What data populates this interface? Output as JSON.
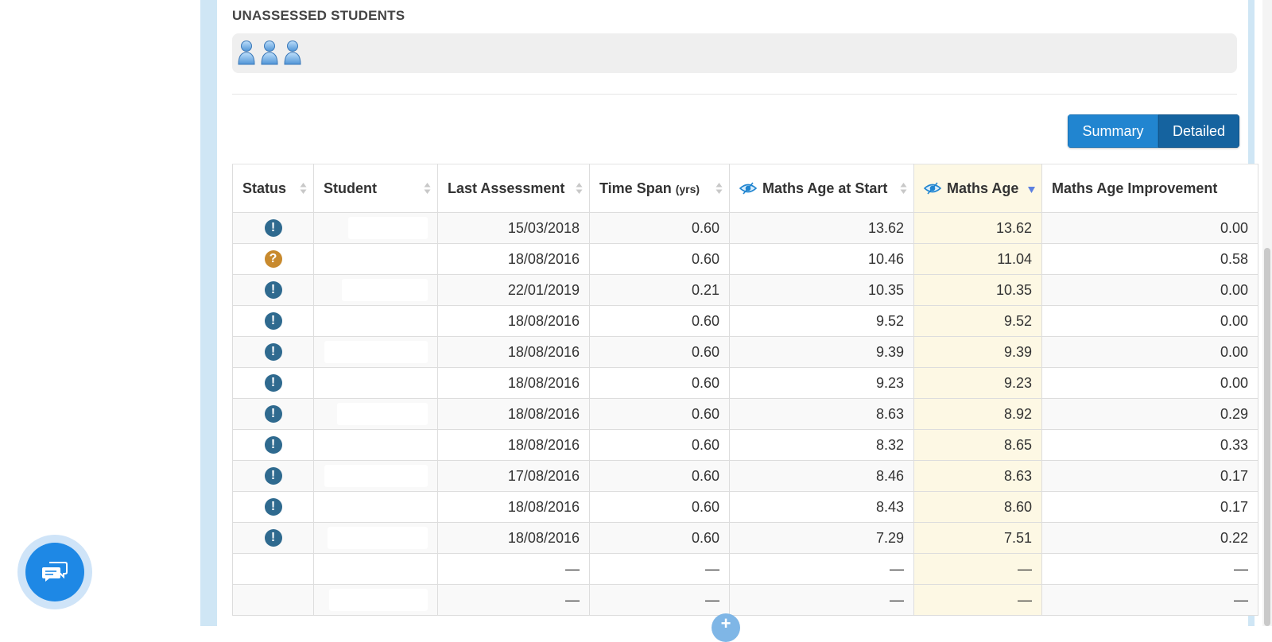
{
  "unassessed": {
    "title": "UNASSESSED STUDENTS",
    "student_icons": [
      "person-icon",
      "person-icon",
      "person-icon"
    ]
  },
  "view_toggle": {
    "summary_label": "Summary",
    "detailed_label": "Detailed",
    "active": "Detailed"
  },
  "table": {
    "columns": {
      "status": "Status",
      "student": "Student",
      "last_assessment": "Last Assessment",
      "time_span": "Time Span",
      "time_span_unit": "(yrs)",
      "maths_age_start": "Maths Age at Start",
      "maths_age": "Maths Age",
      "maths_age_improvement": "Maths Age Improvement"
    },
    "sorted_column": "Maths Age",
    "sort_direction": "descending",
    "rows": [
      {
        "status": "alert",
        "status_glyph": "!",
        "last_assessment": "15/03/2018",
        "time_span": "0.60",
        "maths_age_start": "13.62",
        "maths_age": "13.62",
        "improvement": "0.00"
      },
      {
        "status": "question",
        "status_glyph": "?",
        "last_assessment": "18/08/2016",
        "time_span": "0.60",
        "maths_age_start": "10.46",
        "maths_age": "11.04",
        "improvement": "0.58"
      },
      {
        "status": "alert",
        "status_glyph": "!",
        "last_assessment": "22/01/2019",
        "time_span": "0.21",
        "maths_age_start": "10.35",
        "maths_age": "10.35",
        "improvement": "0.00"
      },
      {
        "status": "alert",
        "status_glyph": "!",
        "last_assessment": "18/08/2016",
        "time_span": "0.60",
        "maths_age_start": "9.52",
        "maths_age": "9.52",
        "improvement": "0.00"
      },
      {
        "status": "alert",
        "status_glyph": "!",
        "last_assessment": "18/08/2016",
        "time_span": "0.60",
        "maths_age_start": "9.39",
        "maths_age": "9.39",
        "improvement": "0.00"
      },
      {
        "status": "alert",
        "status_glyph": "!",
        "last_assessment": "18/08/2016",
        "time_span": "0.60",
        "maths_age_start": "9.23",
        "maths_age": "9.23",
        "improvement": "0.00"
      },
      {
        "status": "alert",
        "status_glyph": "!",
        "last_assessment": "18/08/2016",
        "time_span": "0.60",
        "maths_age_start": "8.63",
        "maths_age": "8.92",
        "improvement": "0.29"
      },
      {
        "status": "alert",
        "status_glyph": "!",
        "last_assessment": "18/08/2016",
        "time_span": "0.60",
        "maths_age_start": "8.32",
        "maths_age": "8.65",
        "improvement": "0.33"
      },
      {
        "status": "alert",
        "status_glyph": "!",
        "last_assessment": "17/08/2016",
        "time_span": "0.60",
        "maths_age_start": "8.46",
        "maths_age": "8.63",
        "improvement": "0.17"
      },
      {
        "status": "alert",
        "status_glyph": "!",
        "last_assessment": "18/08/2016",
        "time_span": "0.60",
        "maths_age_start": "8.43",
        "maths_age": "8.60",
        "improvement": "0.17"
      },
      {
        "status": "alert",
        "status_glyph": "!",
        "last_assessment": "18/08/2016",
        "time_span": "0.60",
        "maths_age_start": "7.29",
        "maths_age": "7.51",
        "improvement": "0.22"
      },
      {
        "status": "",
        "status_glyph": "",
        "last_assessment": "—",
        "time_span": "—",
        "maths_age_start": "—",
        "maths_age": "—",
        "improvement": "—"
      },
      {
        "status": "",
        "status_glyph": "",
        "last_assessment": "—",
        "time_span": "—",
        "maths_age_start": "—",
        "maths_age": "—",
        "improvement": "—"
      }
    ]
  },
  "chat": {
    "icon": "chat-bubbles-icon"
  },
  "fab": {
    "glyph": "+"
  },
  "colors": {
    "accent_blue": "#2185d0",
    "accent_blue_dark": "#15639f",
    "status_alert": "#2f6a8f",
    "status_question": "#c88a2e",
    "highlight_column": "#fdf8e4",
    "frame": "#cfe6f5"
  }
}
